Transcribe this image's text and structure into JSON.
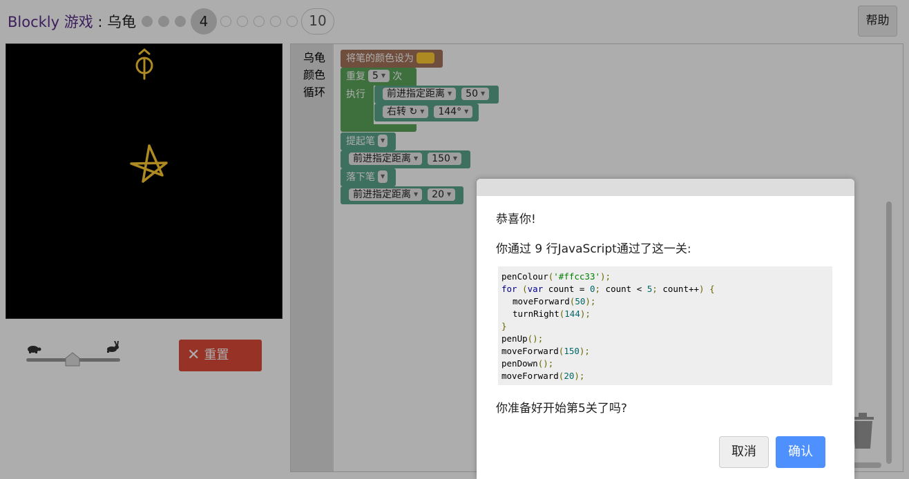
{
  "header": {
    "brand": "Blockly 游戏",
    "separator": " : ",
    "game": "乌龟",
    "levels": {
      "current": "4",
      "last": "10"
    },
    "help_label": "帮助"
  },
  "controls": {
    "reset_label": "重置",
    "reset_color": "#dd4b39"
  },
  "toolbox": {
    "items": [
      "乌龟",
      "颜色",
      "循环"
    ]
  },
  "blocks": {
    "pen_colour": {
      "label": "将笔的颜色设为",
      "color": "#ffcc33"
    },
    "repeat": {
      "label": "重复",
      "count": "5",
      "suffix": "次",
      "do_label": "执行"
    },
    "move1": {
      "dir": "前进指定距离",
      "value": "50"
    },
    "turn1": {
      "dir": "右转 ↻",
      "value": "144°"
    },
    "pen_up": {
      "label": "提起笔"
    },
    "move2": {
      "dir": "前进指定距离",
      "value": "150"
    },
    "pen_down": {
      "label": "落下笔"
    },
    "move3": {
      "dir": "前进指定距离",
      "value": "20"
    }
  },
  "dialog": {
    "congrats": "恭喜你!",
    "summary": "你通过 9 行JavaScript通过了这一关:",
    "code": {
      "l1_fn": "penColour",
      "l1_arg": "'#ffcc33'",
      "l2_for": "for",
      "l2_var": "var",
      "l2_init": " count = ",
      "l2_zero": "0",
      "l2_cond": " count < ",
      "l2_five": "5",
      "l2_incr": " count++",
      "l3_fn": "moveForward",
      "l3_arg": "50",
      "l4_fn": "turnRight",
      "l4_arg": "144",
      "l6_fn": "penUp",
      "l7_fn": "moveForward",
      "l7_arg": "150",
      "l8_fn": "penDown",
      "l9_fn": "moveForward",
      "l9_arg": "20"
    },
    "next_question": "你准备好开始第5关了吗?",
    "cancel_label": "取消",
    "ok_label": "确认",
    "ok_color": "#4d90fe"
  }
}
